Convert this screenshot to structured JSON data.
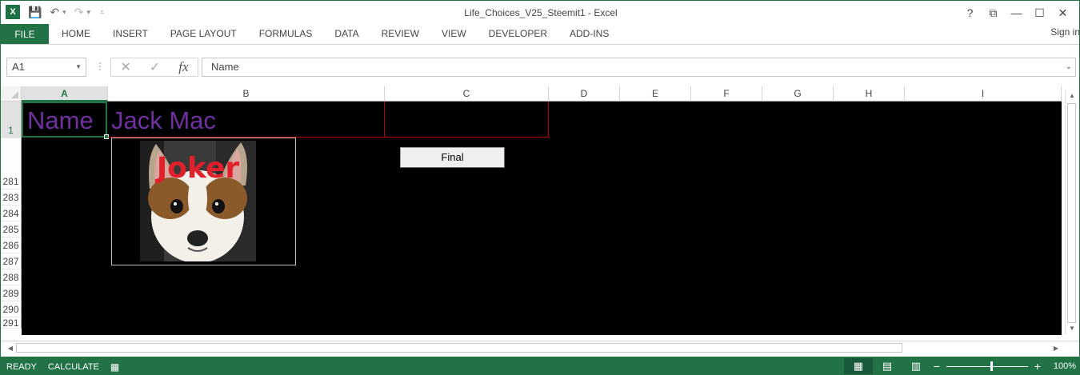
{
  "window": {
    "title": "Life_Choices_V25_Steemit1 - Excel",
    "logo": "X",
    "controls": [
      "?",
      "⧉",
      "—",
      "☐",
      "✕"
    ]
  },
  "ribbon": {
    "file_label": "FILE",
    "tabs": [
      "HOME",
      "INSERT",
      "PAGE LAYOUT",
      "FORMULAS",
      "DATA",
      "REVIEW",
      "VIEW",
      "DEVELOPER",
      "ADD-INS"
    ],
    "signin": "Sign in"
  },
  "formula_bar": {
    "name_box": "A1",
    "fx_label": "fx",
    "content": "Name"
  },
  "grid": {
    "columns": [
      "A",
      "B",
      "C",
      "D",
      "E",
      "F",
      "G",
      "H",
      "I"
    ],
    "rows": [
      "1",
      "281",
      "283",
      "284",
      "285",
      "286",
      "287",
      "288",
      "289",
      "290",
      "291"
    ],
    "cell_a1": "Name",
    "cell_b1": "Jack Mac",
    "picture_caption": "Joker",
    "button_label": "Final"
  },
  "status": {
    "ready": "READY",
    "calculate": "CALCULATE",
    "zoom": "100%"
  },
  "colors": {
    "excel_green": "#217346",
    "cell_text": "#7030a0",
    "border_red": "#c00000",
    "joker_red": "#e0202a"
  }
}
